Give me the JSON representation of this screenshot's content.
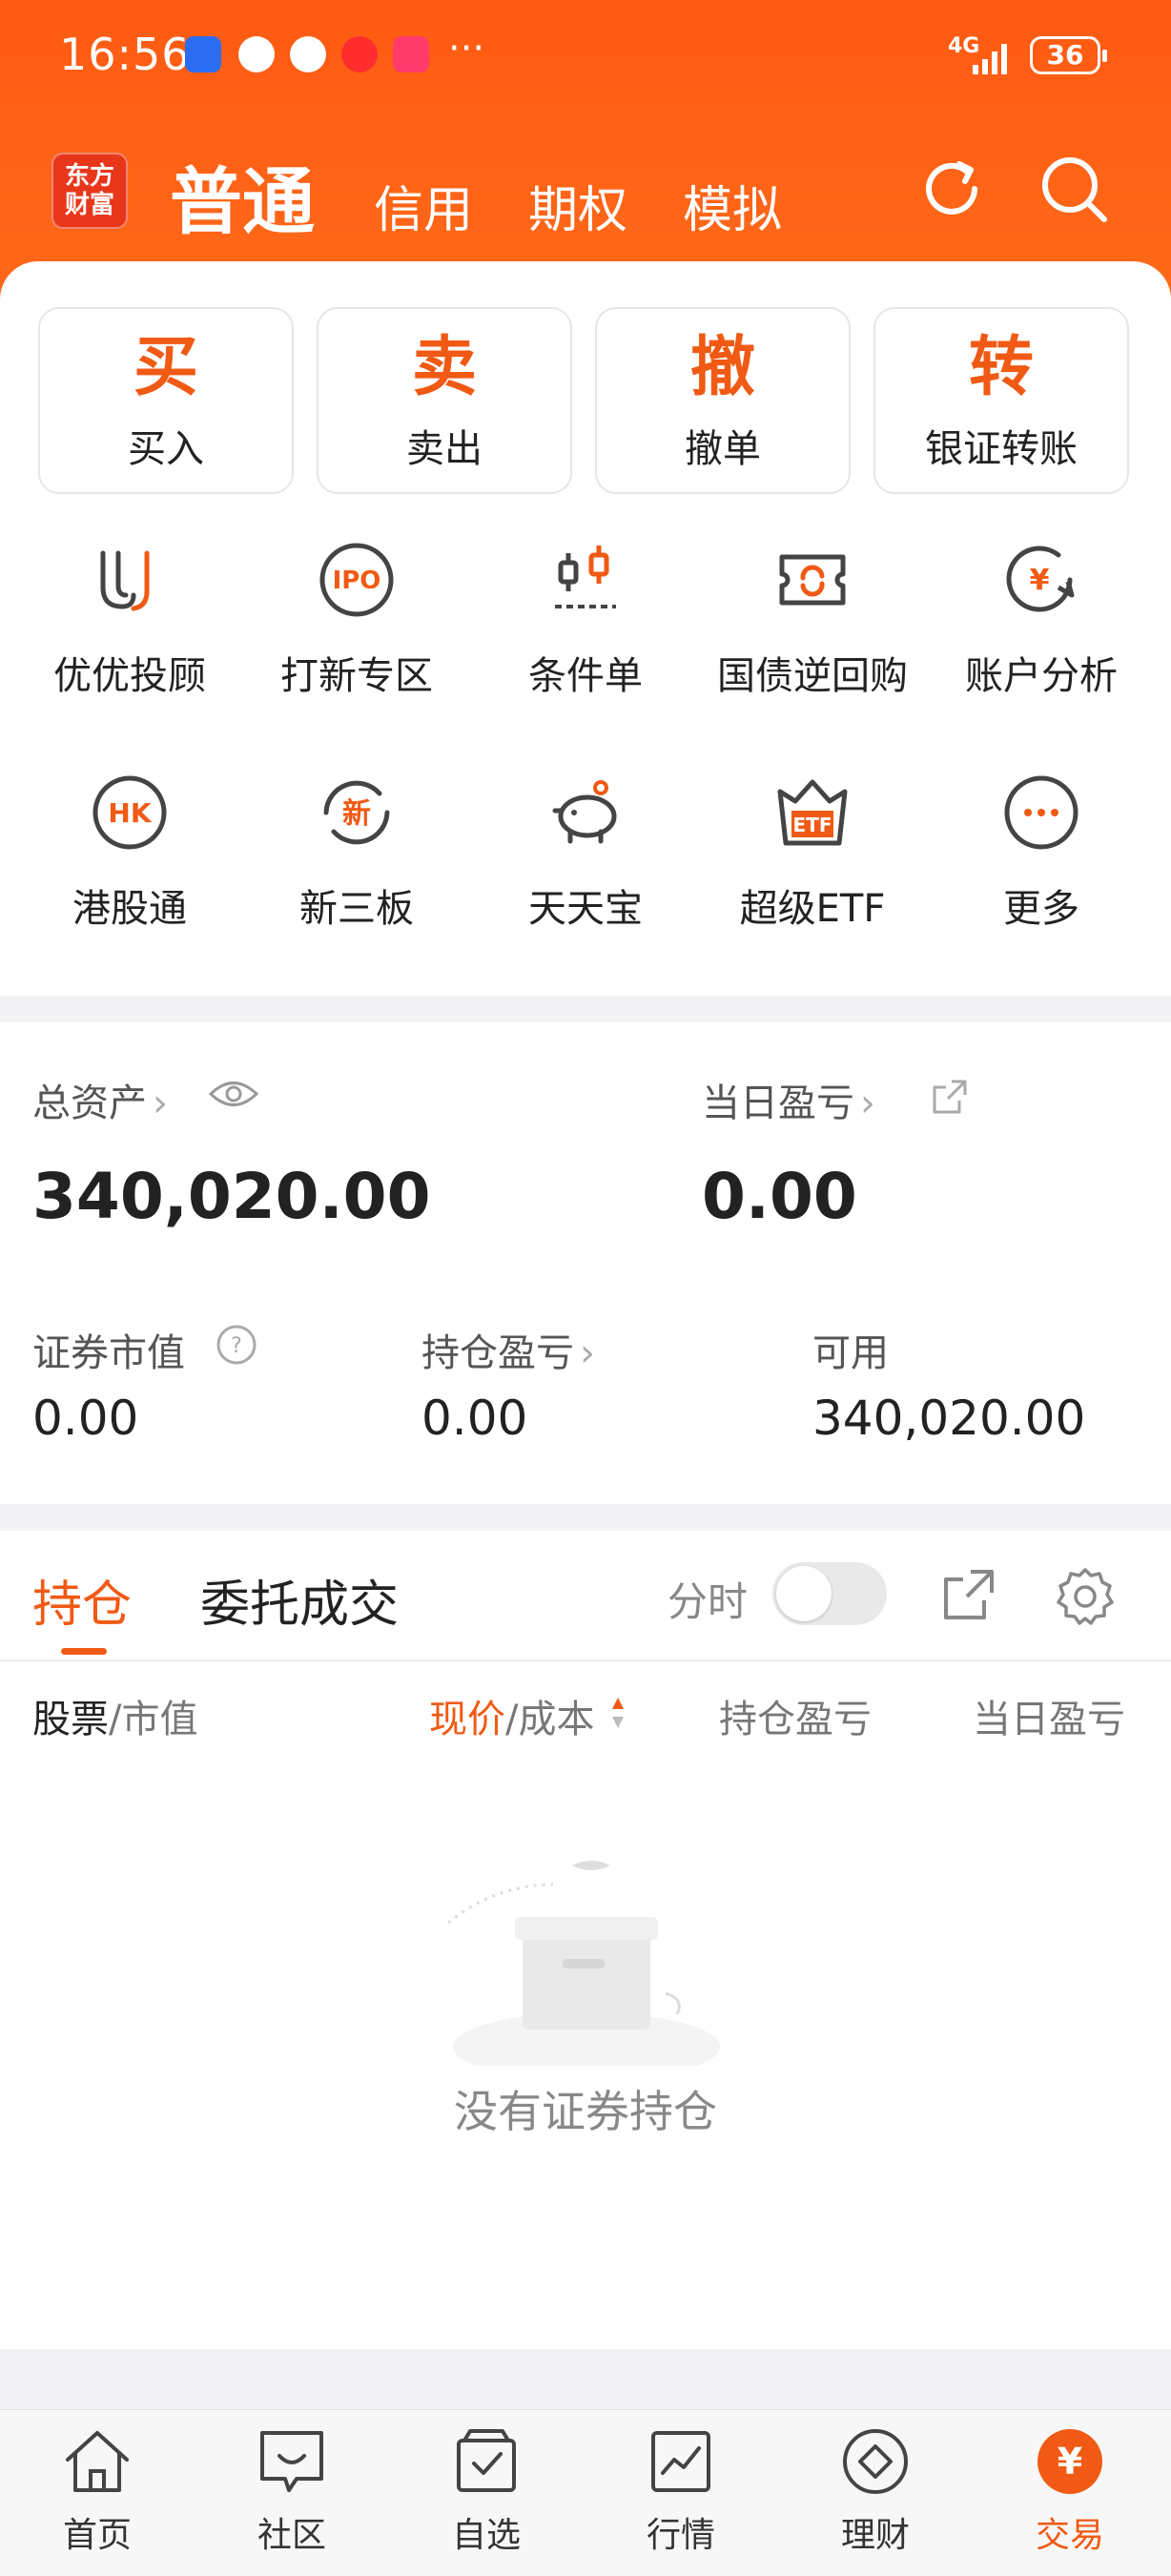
{
  "status_bar": {
    "time": "16:56",
    "overflow": "···",
    "network": "4G",
    "battery": "36"
  },
  "header": {
    "logo_text": "东方财富",
    "tabs": [
      {
        "label": "普通",
        "active": true
      },
      {
        "label": "信用"
      },
      {
        "label": "期权"
      },
      {
        "label": "模拟"
      }
    ],
    "refresh_icon": "refresh-icon",
    "search_icon": "search-icon"
  },
  "actions": [
    {
      "big": "买",
      "label": "买入"
    },
    {
      "big": "卖",
      "label": "卖出"
    },
    {
      "big": "撤",
      "label": "撤单"
    },
    {
      "big": "转",
      "label": "银证转账"
    }
  ],
  "grid": [
    {
      "label": "优优投顾",
      "icon": "uu-icon"
    },
    {
      "label": "打新专区",
      "icon": "ipo-icon",
      "icon_text": "IPO"
    },
    {
      "label": "条件单",
      "icon": "condition-order-icon"
    },
    {
      "label": "国债逆回购",
      "icon": "repo-icon"
    },
    {
      "label": "账户分析",
      "icon": "account-analysis-icon",
      "icon_text": "¥"
    },
    {
      "label": "港股通",
      "icon": "hk-icon",
      "icon_text": "HK"
    },
    {
      "label": "新三板",
      "icon": "new-third-board-icon",
      "icon_text": "新"
    },
    {
      "label": "天天宝",
      "icon": "piggy-bank-icon"
    },
    {
      "label": "超级ETF",
      "icon": "etf-icon",
      "icon_text": "ETF"
    },
    {
      "label": "更多",
      "icon": "more-icon"
    }
  ],
  "assets": {
    "total_label": "总资产",
    "total_value": "340,020.00",
    "daily_pnl_label": "当日盈亏",
    "daily_pnl_value": "0.00",
    "market_value_label": "证券市值",
    "market_value": "0.00",
    "position_pnl_label": "持仓盈亏",
    "position_pnl": "0.00",
    "available_label": "可用",
    "available": "340,020.00"
  },
  "positions": {
    "tabs": [
      {
        "label": "持仓",
        "active": true
      },
      {
        "label": "委托成交"
      }
    ],
    "timeshare_label": "分时",
    "timeshare_on": false,
    "col_stock": "股票",
    "col_mv": "/市值",
    "col_price": "现价",
    "col_cost": "/成本",
    "col_pos_pnl": "持仓盈亏",
    "col_daily_pnl": "当日盈亏",
    "empty_text": "没有证券持仓"
  },
  "colors": {
    "accent": "#F05A14",
    "header": "#FF5F15"
  },
  "bottom_nav": [
    {
      "label": "首页",
      "icon": "home-icon"
    },
    {
      "label": "社区",
      "icon": "community-icon"
    },
    {
      "label": "自选",
      "icon": "watchlist-icon"
    },
    {
      "label": "行情",
      "icon": "market-icon"
    },
    {
      "label": "理财",
      "icon": "wealth-icon"
    },
    {
      "label": "交易",
      "icon": "trade-icon",
      "icon_text": "¥",
      "active": true
    }
  ]
}
